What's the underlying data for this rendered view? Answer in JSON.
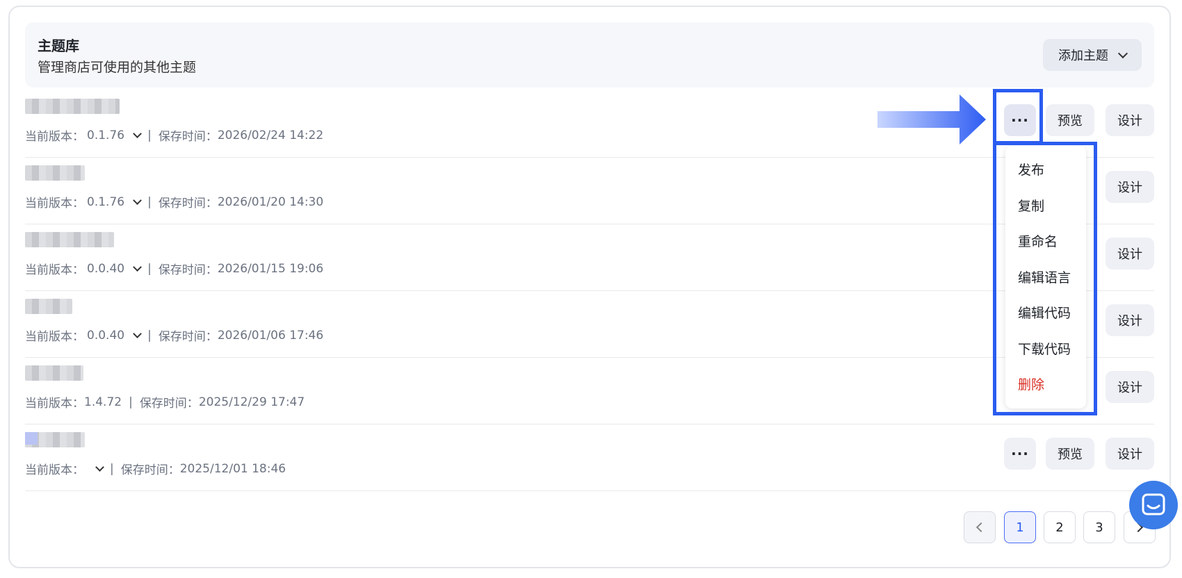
{
  "header": {
    "title": "主题库",
    "subtitle": "管理商店可使用的其他主题",
    "add_button_label": "添加主题"
  },
  "labels": {
    "version_prefix": "当前版本：",
    "saved_prefix": "保存时间：",
    "separator": "|",
    "more": "···",
    "preview": "预览",
    "design": "设计"
  },
  "themes": [
    {
      "version": "0.1.76",
      "saved": "2026/02/24 14:22"
    },
    {
      "version": "0.1.76",
      "saved": "2026/01/20 14:30"
    },
    {
      "version": "0.0.40",
      "saved": "2026/01/15 19:06"
    },
    {
      "version": "0.0.40",
      "saved": "2026/01/06 17:46"
    },
    {
      "version": "1.4.72",
      "saved": "2025/12/29 17:47"
    },
    {
      "version": "",
      "saved": "2025/12/01 18:46"
    }
  ],
  "dropdown": {
    "items": [
      "发布",
      "复制",
      "重命名",
      "编辑语言",
      "编辑代码",
      "下载代码",
      "删除"
    ]
  },
  "pagination": {
    "pages": [
      "1",
      "2",
      "3"
    ],
    "current": "1"
  },
  "colors": {
    "accent": "#2b5cf0",
    "danger": "#d93025",
    "chat": "#3a7ce8"
  }
}
